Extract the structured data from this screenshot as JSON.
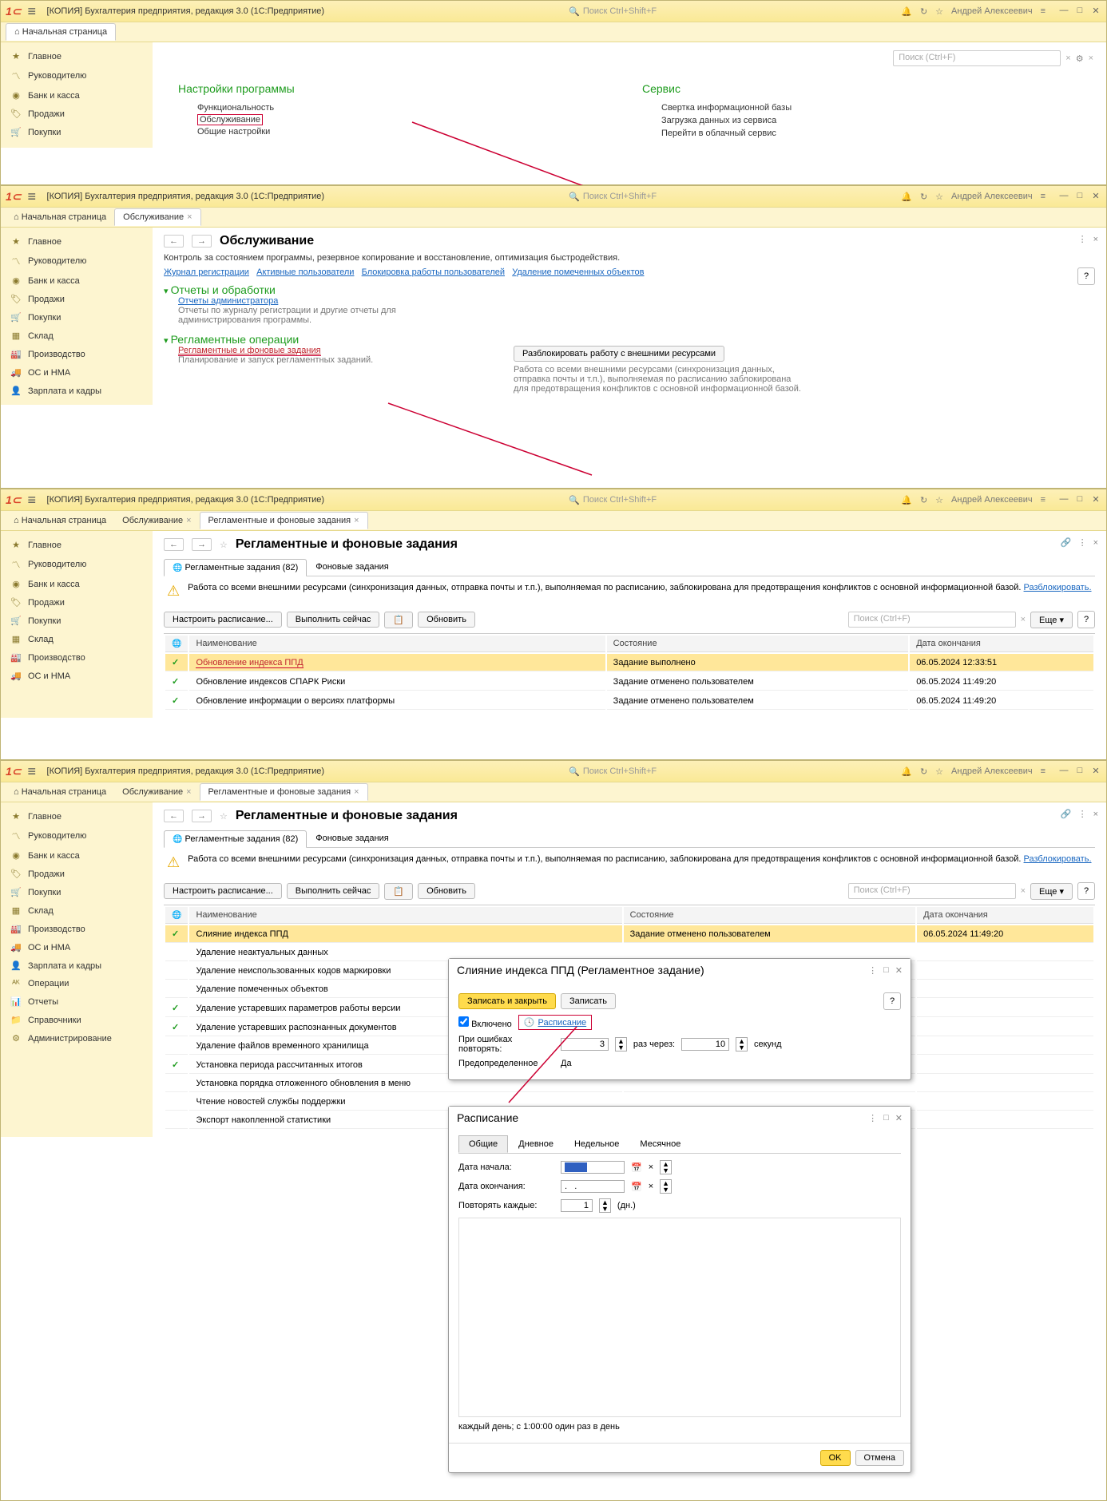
{
  "app_title": "[КОПИЯ] Бухгалтерия предприятия, редакция 3.0  (1C:Предприятие)",
  "search_placeholder": "Поиск Ctrl+Shift+F",
  "user": "Андрей Алексеевич",
  "tab_home": "Начальная страница",
  "tab_service": "Обслуживание",
  "tab_jobs": "Регламентные и фоновые задания",
  "sidebar": {
    "main": "Главное",
    "head": "Руководителю",
    "bank": "Банк и касса",
    "sales": "Продажи",
    "buy": "Покупки",
    "stock": "Склад",
    "prod": "Производство",
    "os": "ОС и НМА",
    "salary": "Зарплата и кадры",
    "ops": "Операции",
    "reports": "Отчеты",
    "refs": "Справочники",
    "admin": "Администрирование"
  },
  "s1": {
    "prog_settings": "Настройки программы",
    "func": "Функциональность",
    "service": "Обслуживание",
    "general": "Общие настройки",
    "service_h": "Сервис",
    "svc1": "Свертка информационной базы",
    "svc2": "Загрузка данных из сервиса",
    "svc3": "Перейти в облачный сервис",
    "search_ph": "Поиск (Ctrl+F)"
  },
  "s2": {
    "h": "Обслуживание",
    "desc": "Контроль за состоянием программы, резервное копирование и восстановление, оптимизация быстродействия.",
    "l1": "Журнал регистрации",
    "l2": "Активные пользователи",
    "l3": "Блокировка работы пользователей",
    "l4": "Удаление помеченных объектов",
    "sec1": "Отчеты и обработки",
    "sec1l": "Отчеты администратора",
    "sec1d": "Отчеты по журналу регистрации и другие отчеты для администрирования программы.",
    "sec2": "Регламентные операции",
    "sec2l": "Регламентные и фоновые задания",
    "sec2d": "Планирование и запуск регламентных заданий.",
    "unblock": "Разблокировать работу с внешними ресурсами",
    "unblock_d1": "Работа со всеми внешними ресурсами (синхронизация данных,",
    "unblock_d2": "отправка почты и т.п.), выполняемая по расписанию заблокирована",
    "unblock_d3": "для предотвращения конфликтов с основной информационной базой."
  },
  "s3": {
    "h": "Регламентные и фоновые задания",
    "subtab1": "Регламентные задания (82)",
    "subtab2": "Фоновые задания",
    "warn": "Работа со всеми внешними ресурсами (синхронизация данных, отправка почты и т.п.), выполняемая по расписанию, заблокирована для предотвращения конфликтов с основной информационной базой. ",
    "warn_link": "Разблокировать.",
    "b1": "Настроить расписание...",
    "b2": "Выполнить сейчас",
    "b3": "Обновить",
    "more": "Еще",
    "col1": "Наименование",
    "col2": "Состояние",
    "col3": "Дата окончания",
    "rows": [
      {
        "chk": "✓",
        "n": "Обновление индекса ППД",
        "s": "Задание выполнено",
        "d": "06.05.2024 12:33:51",
        "sel": true,
        "red": true
      },
      {
        "chk": "✓",
        "n": "Обновление индексов СПАРК Риски",
        "s": "Задание отменено пользователем",
        "d": "06.05.2024 11:49:20"
      },
      {
        "chk": "✓",
        "n": "Обновление информации о версиях платформы",
        "s": "Задание отменено пользователем",
        "d": "06.05.2024 11:49:20"
      }
    ]
  },
  "s4": {
    "rows": [
      {
        "chk": "✓",
        "n": "Слияние индекса ППД",
        "s": "Задание отменено пользователем",
        "d": "06.05.2024 11:49:20",
        "sel": true
      },
      {
        "chk": "",
        "n": "Удаление неактуальных данных",
        "s": "",
        "d": ""
      },
      {
        "chk": "",
        "n": "Удаление неиспользованных кодов маркировки",
        "s": "",
        "d": ""
      },
      {
        "chk": "",
        "n": "Удаление помеченных объектов",
        "s": "",
        "d": ""
      },
      {
        "chk": "✓",
        "n": "Удаление устаревших параметров работы версии",
        "s": "",
        "d": ""
      },
      {
        "chk": "✓",
        "n": "Удаление устаревших распознанных документов",
        "s": "",
        "d": ""
      },
      {
        "chk": "",
        "n": "Удаление файлов временного хранилища",
        "s": "",
        "d": ""
      },
      {
        "chk": "✓",
        "n": "Установка периода рассчитанных итогов",
        "s": "",
        "d": ""
      },
      {
        "chk": "",
        "n": "Установка порядка отложенного обновления в меню",
        "s": "",
        "d": ""
      },
      {
        "chk": "",
        "n": "Чтение новостей службы поддержки",
        "s": "",
        "d": ""
      },
      {
        "chk": "",
        "n": "Экспорт накопленной статистики",
        "s": "",
        "d": ""
      }
    ],
    "modal1": {
      "title": "Слияние индекса ППД (Регламентное задание)",
      "save_close": "Записать и закрыть",
      "save": "Записать",
      "enabled": "Включено",
      "schedule": "Расписание",
      "onerr": "При ошибках повторять:",
      "times": "раз через:",
      "sec": "секунд",
      "v1": "3",
      "v2": "10",
      "predef": "Предопределенное",
      "predef_v": "Да"
    },
    "modal2": {
      "title": "Расписание",
      "t1": "Общие",
      "t2": "Дневное",
      "t3": "Недельное",
      "t4": "Месячное",
      "date_start": "Дата начала:",
      "date_end": "Дата окончания:",
      "repeat": "Повторять каждые:",
      "days": "(дн.)",
      "rv": "1",
      "summary": "каждый день; с 1:00:00 один раз в день",
      "ok": "OK",
      "cancel": "Отмена"
    }
  }
}
